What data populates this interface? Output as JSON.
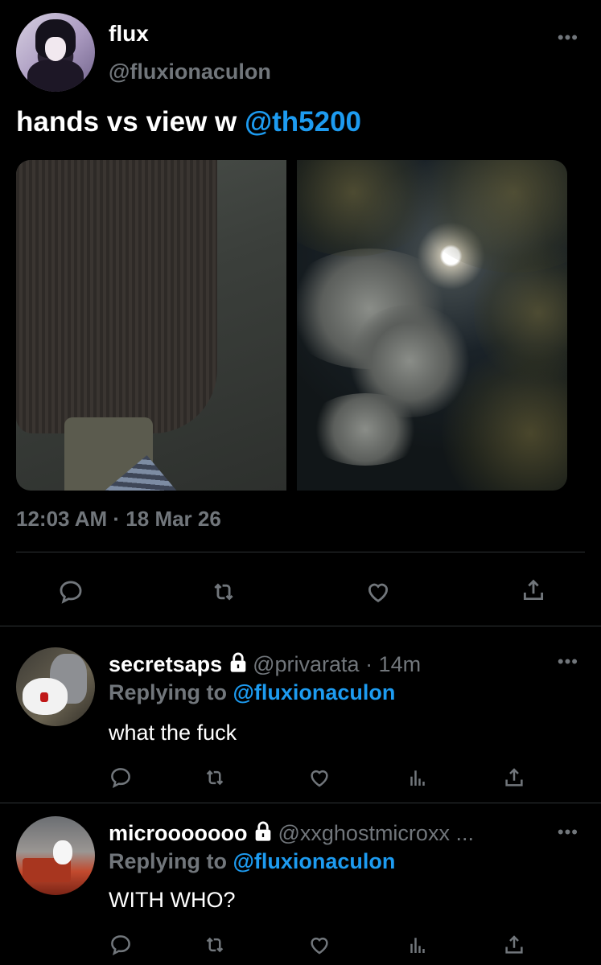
{
  "tweet": {
    "author_name": "flux",
    "author_handle": "@fluxionaculon",
    "text": "hands vs view w ",
    "mention": "@th5200",
    "timestamp": "12:03 AM · 18 Mar 26",
    "more_icon": "more-icon"
  },
  "main_actions": [
    "reply-icon",
    "retweet-icon",
    "like-icon",
    "share-icon"
  ],
  "replies": [
    {
      "name": "secretsaps",
      "handle_time": "@privarata · 14m",
      "replying_prefix": "Replying to ",
      "replying_to": "@fluxionaculon",
      "text": "what the fuck"
    },
    {
      "name": "microoooooo",
      "handle_time": "@xxghostmicroxx ...",
      "replying_prefix": "Replying to ",
      "replying_to": "@fluxionaculon",
      "text": "WITH WHO?"
    }
  ],
  "reply_actions": [
    "reply-icon",
    "retweet-icon",
    "like-icon",
    "analytics-icon",
    "share-icon"
  ],
  "colors": {
    "background": "#000000",
    "primary_text": "#ffffff",
    "secondary_text": "#71767b",
    "accent": "#1d9bf0",
    "divider": "#2f3336"
  }
}
